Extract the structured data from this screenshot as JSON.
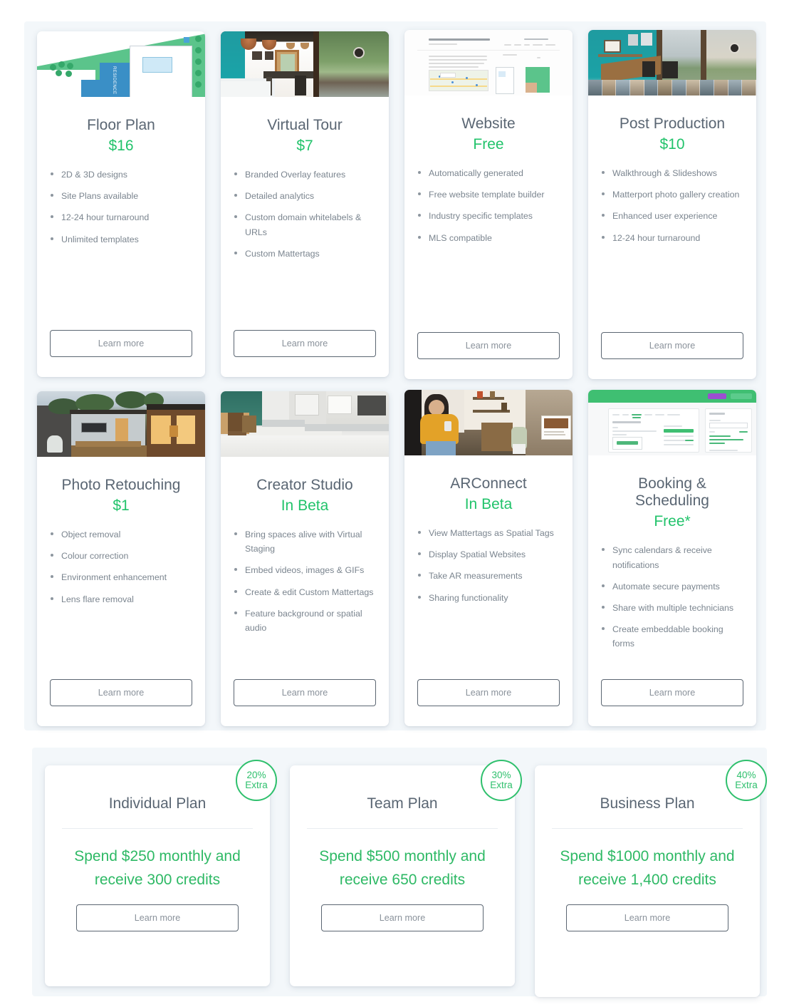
{
  "theme": {
    "accent_green": "#22c36b",
    "badge_green": "#2fc06d",
    "title_gray": "#5a6673",
    "body_gray": "#7b858f",
    "section_bg": "#f3f7fa",
    "card_bg": "#ffffff"
  },
  "common": {
    "learn_more_label": "Learn more"
  },
  "services": [
    {
      "id": "floor-plan",
      "title": "Floor Plan",
      "price": "$16",
      "thumb": "site-plan-illustration",
      "features": [
        "2D & 3D designs",
        "Site Plans available",
        "12-24 hour turnaround",
        "Unlimited templates"
      ]
    },
    {
      "id": "virtual-tour",
      "title": "Virtual Tour",
      "price": "$7",
      "thumb": "kitchen-interior-photo",
      "features": [
        "Branded Overlay features",
        "Detailed analytics",
        "Custom domain whitelabels & URLs",
        "Custom Mattertags"
      ]
    },
    {
      "id": "website",
      "title": "Website",
      "price": "Free",
      "thumb": "website-preview-screenshot",
      "features": [
        "Automatically generated",
        "Free website template builder",
        "Industry specific templates",
        "MLS compatible"
      ]
    },
    {
      "id": "post-production",
      "title": "Post Production",
      "price": "$10",
      "thumb": "dining-room-photo-gallery",
      "features": [
        "Walkthrough & Slideshows",
        "Matterport photo gallery creation",
        "Enhanced user experience",
        "12-24 hour turnaround"
      ]
    },
    {
      "id": "photo-retouching",
      "title": "Photo Retouching",
      "price": "$1",
      "thumb": "house-exterior-dusk-photo",
      "features": [
        "Object removal",
        "Colour correction",
        "Environment enhancement",
        "Lens flare removal"
      ]
    },
    {
      "id": "creator-studio",
      "title": "Creator Studio",
      "price": "In Beta",
      "thumb": "staged-kitchen-photo",
      "features": [
        "Bring spaces alive with Virtual Staging",
        "Embed videos, images & GIFs",
        "Create & edit Custom Mattertags",
        "Feature background or spatial audio"
      ]
    },
    {
      "id": "arconnect",
      "title": "ARConnect",
      "price": "In Beta",
      "thumb": "woman-with-phone-photo",
      "features": [
        "View Mattertags as Spatial Tags",
        "Display Spatial Websites",
        "Take AR measurements",
        "Sharing functionality"
      ]
    },
    {
      "id": "booking-scheduling",
      "title": "Booking & Scheduling",
      "price": "Free*",
      "thumb": "booking-dashboard-screenshot",
      "features": [
        "Sync calendars & receive notifications",
        "Automate secure payments",
        "Share with multiple technicians",
        "Create embeddable booking forms"
      ]
    }
  ],
  "plans": [
    {
      "id": "individual-plan",
      "title": "Individual Plan",
      "description": "Spend $250 monthly and receive 300 credits",
      "badge_percent": "20%",
      "badge_label": "Extra"
    },
    {
      "id": "team-plan",
      "title": "Team Plan",
      "description": "Spend $500 monthly and receive 650 credits",
      "badge_percent": "30%",
      "badge_label": "Extra"
    },
    {
      "id": "business-plan",
      "title": "Business Plan",
      "description": "Spend $1000 monthly and receive 1,400 credits",
      "badge_percent": "40%",
      "badge_label": "Extra"
    }
  ]
}
